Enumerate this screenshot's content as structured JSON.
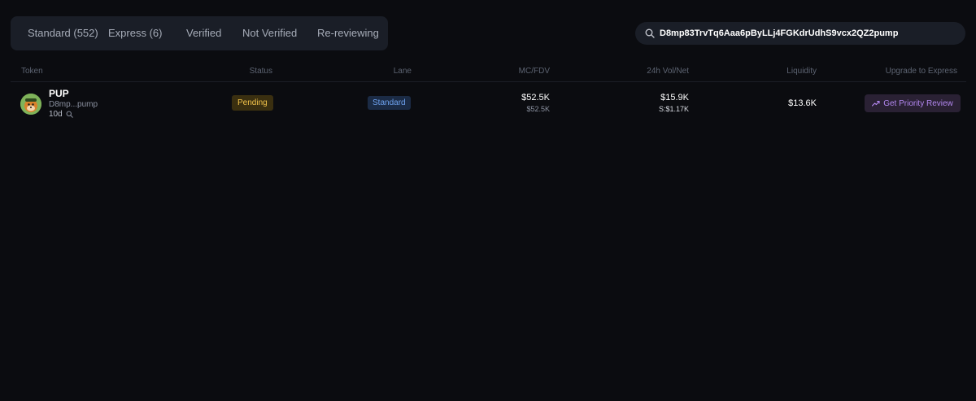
{
  "tabs": [
    {
      "label": "Standard (552)"
    },
    {
      "label": "Express (6)"
    },
    {
      "label": "Verified"
    },
    {
      "label": "Not Verified"
    },
    {
      "label": "Re-reviewing"
    }
  ],
  "search": {
    "value": "D8mp83TrvTq6Aaa6pByLLj4FGKdrUdhS9vcx2QZ2pump",
    "icon": "search-icon"
  },
  "table": {
    "columns": {
      "token": "Token",
      "status": "Status",
      "lane": "Lane",
      "mc_fdv": "MC/FDV",
      "vol_net": "24h Vol/Net",
      "liquidity": "Liquidity",
      "upgrade": "Upgrade to Express"
    },
    "rows": [
      {
        "name": "PUP",
        "address": "D8mp...pump",
        "age": "10d",
        "status": "Pending",
        "lane": "Standard",
        "mc": "$52.5K",
        "fdv": "$52.5K",
        "vol": "$15.9K",
        "net": "S:$1.17K",
        "liquidity": "$13.6K",
        "action": "Get Priority Review"
      }
    ]
  },
  "colors": {
    "background": "#0b0c10",
    "panel": "#1a1e27",
    "pending": "#f2c34a",
    "lane": "#6ea2ef",
    "accent": "#b387f0"
  }
}
